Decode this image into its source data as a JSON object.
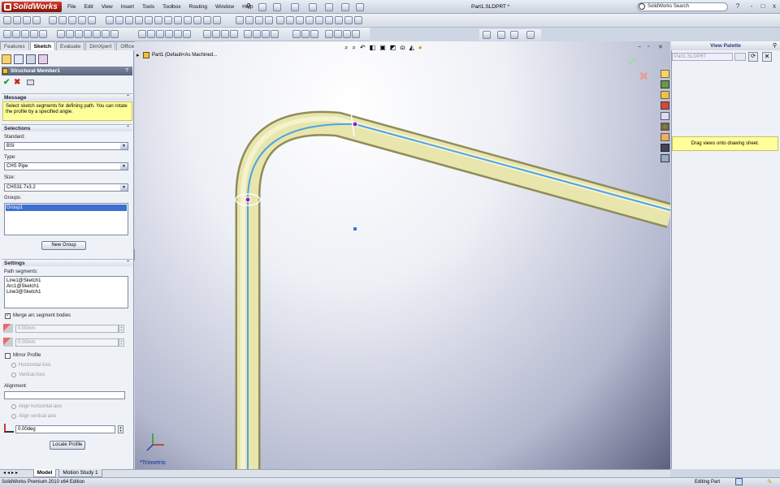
{
  "app": {
    "name": "SolidWorks",
    "menu": [
      "File",
      "Edit",
      "View",
      "Insert",
      "Tools",
      "Toolbox",
      "Routing",
      "Window",
      "Help"
    ],
    "document_title": "Part1.SLDPRT *",
    "search_placeholder": "SolidWorks Search",
    "window_controls": [
      "?",
      "-",
      "□",
      "x"
    ]
  },
  "command_tabs": [
    "Features",
    "Sketch",
    "Evaluate",
    "DimXpert",
    "Office Products"
  ],
  "active_tab": "Sketch",
  "property_manager": {
    "title": "Structural Member1",
    "help": "?",
    "message_header": "Message",
    "message_text": "Select sketch segments for defining path. You can rotate the profile by a specified angle.",
    "selections_header": "Selections",
    "standard_label": "Standard:",
    "standard_value": "BSI",
    "type_label": "Type:",
    "type_value": "CHS Pipe",
    "size_label": "Size:",
    "size_value": "CHS31.7x3.2",
    "groups_label": "Groups:",
    "groups": [
      "Group1"
    ],
    "new_group_button": "New Group",
    "settings_header": "Settings",
    "path_segments_label": "Path segments:",
    "path_segments": [
      "Line1@Sketch1",
      "Arc1@Sketch1",
      "Line3@Sketch1"
    ],
    "merge_arc_label": "Merge arc segment bodies",
    "gap1_value": "0.00mm",
    "gap2_value": "0.00mm",
    "mirror_profile_label": "Mirror Profile",
    "horizontal_axis_label": "Horizontal Axis",
    "vertical_axis_label": "Vertical Axis",
    "alignment_label": "Alignment:",
    "align_horizontal_label": "Align horizontal axis",
    "align_vertical_label": "Align vertical axis",
    "angle_value": "0.00deg",
    "locate_profile_button": "Locate Profile"
  },
  "viewport": {
    "breadcrumb": "Part1 (Default<As Machined...",
    "view_label": "*Trimetric"
  },
  "palette": {
    "title": "View Palette",
    "dropdown_value": "Part1.SLDPRT",
    "hint": "Drag views onto drawing sheet."
  },
  "bottom_tabs": [
    "Model",
    "Motion Study 1"
  ],
  "status": {
    "edition": "SolidWorks Premium 2010 x64 Edition",
    "mode": "Editing Part"
  },
  "colors": {
    "pipe": "#e4e1a4",
    "path": "#4aa3e8",
    "message_bg": "#ffff99",
    "accent_red": "#c0291a"
  }
}
